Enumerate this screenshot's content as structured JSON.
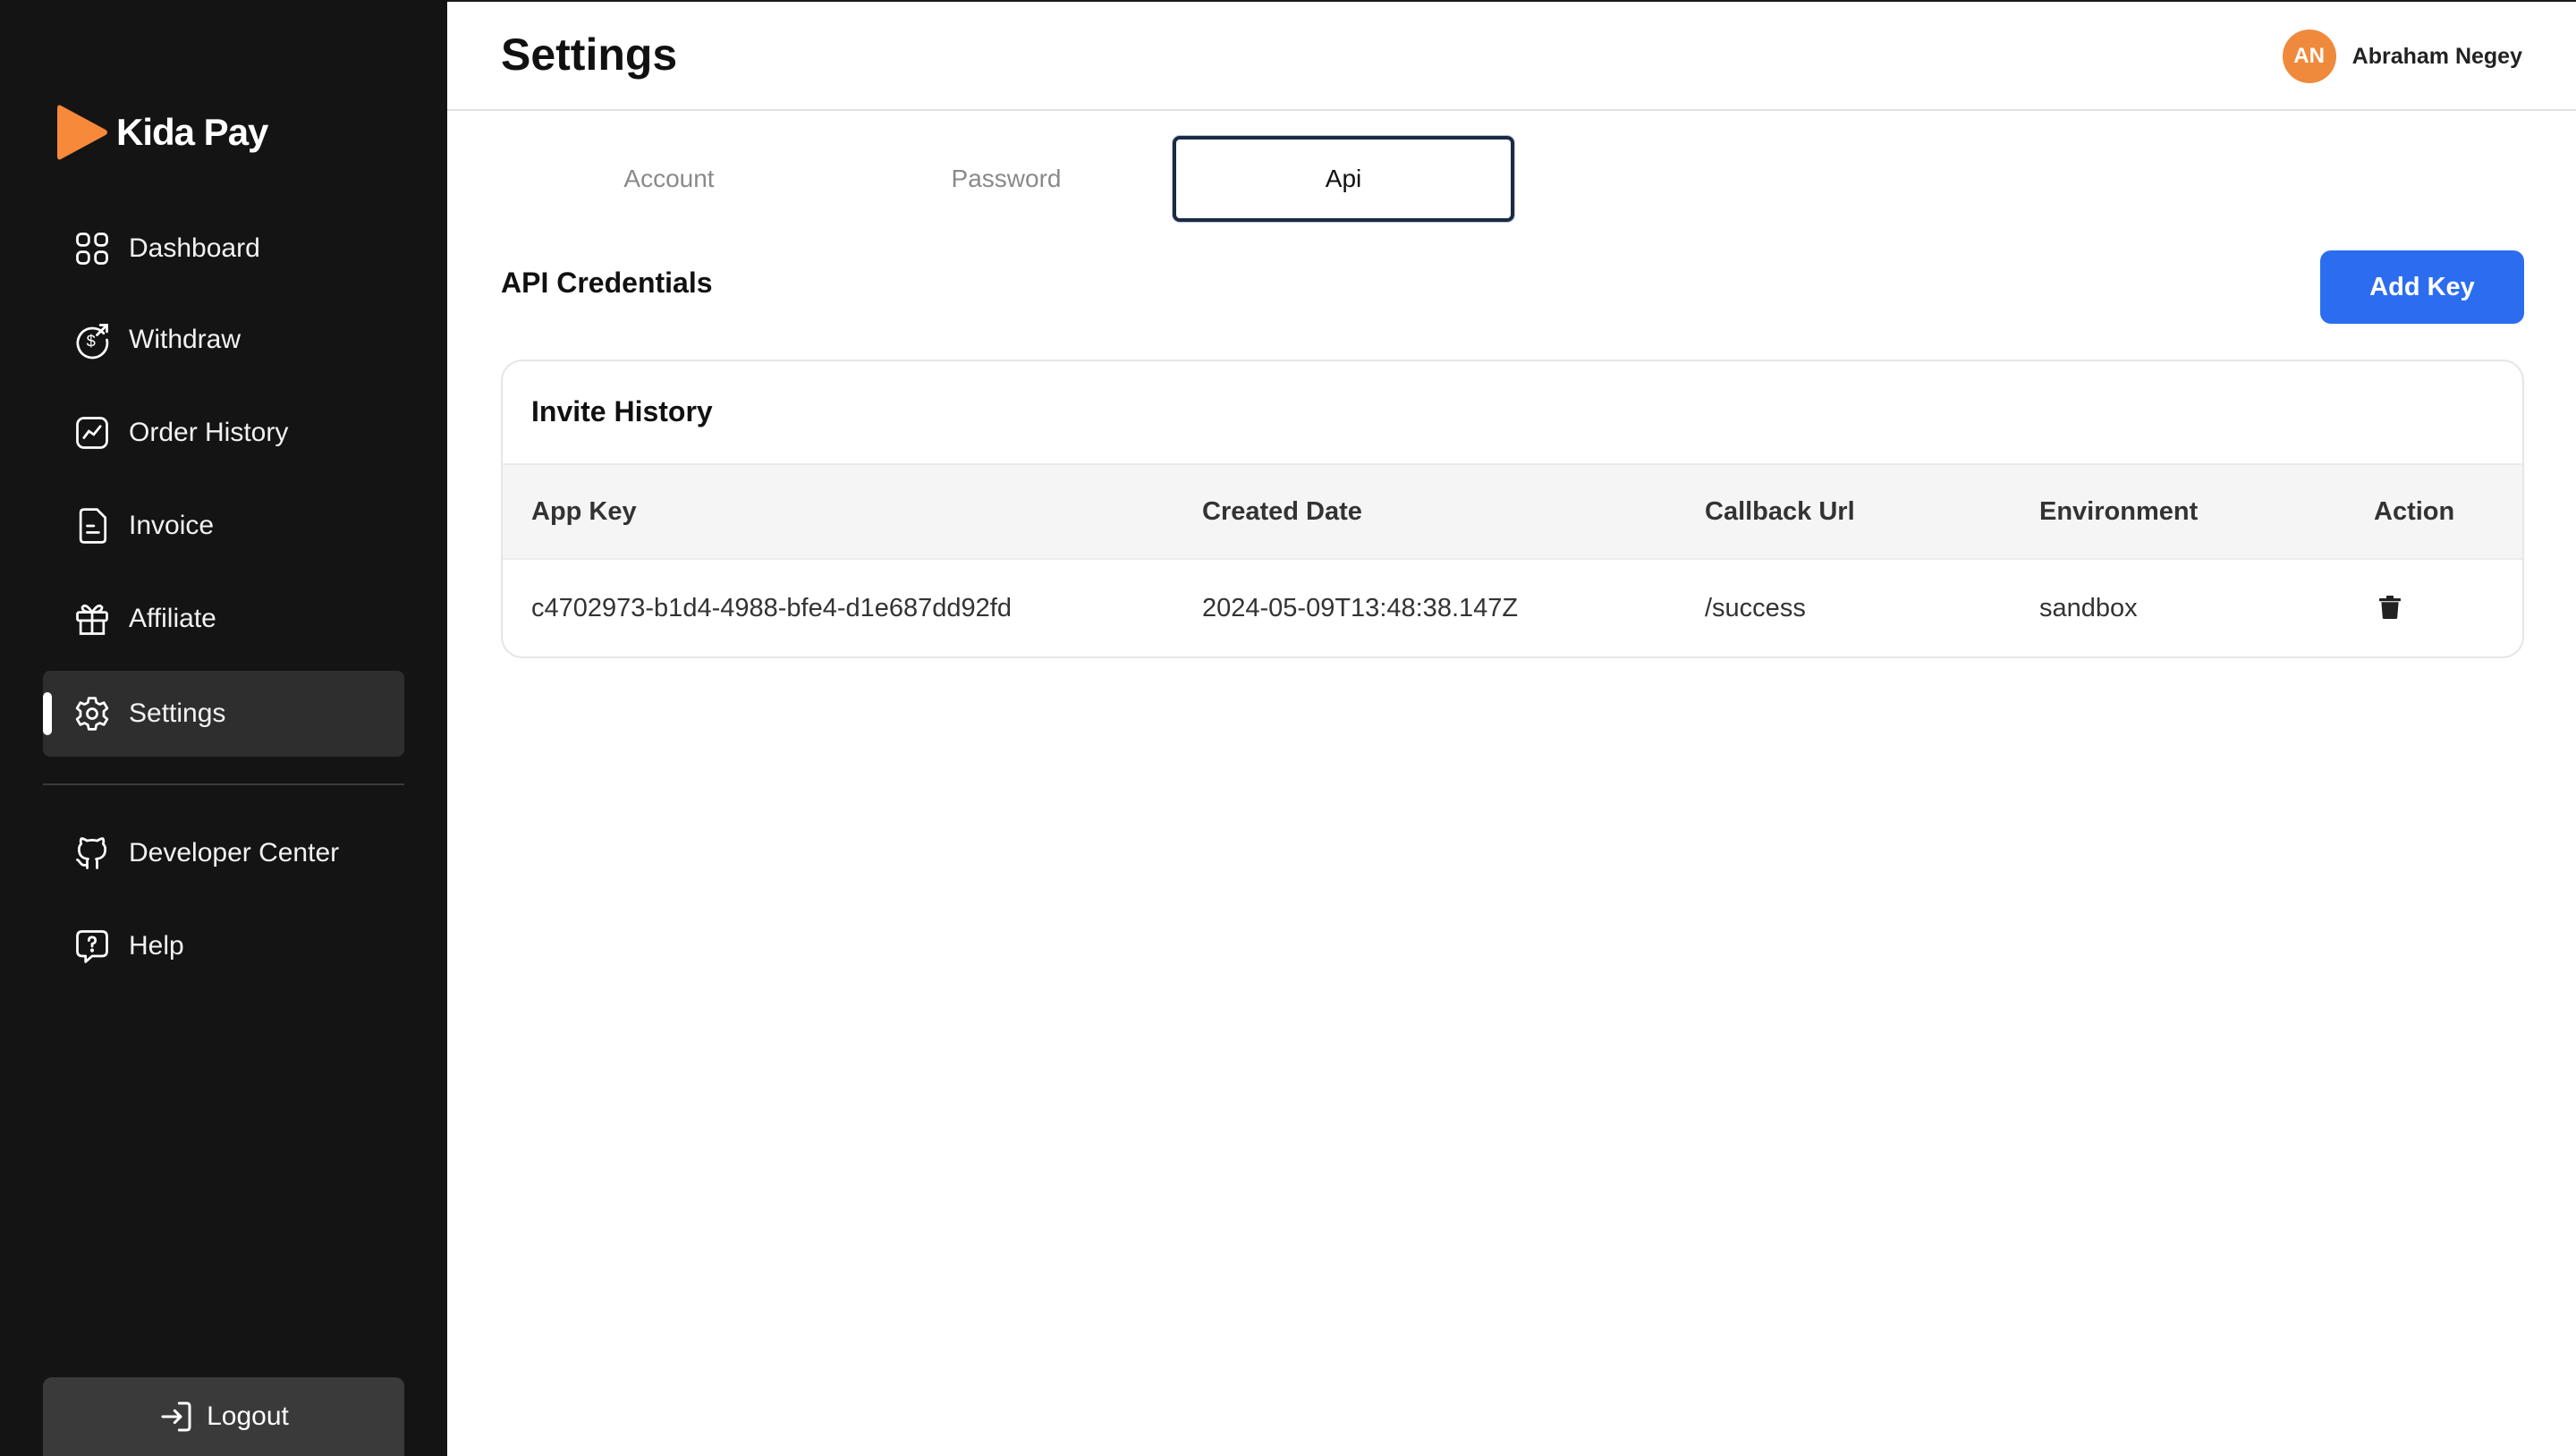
{
  "brand": {
    "name": "Kida Pay",
    "logo_color": "#f7893a"
  },
  "sidebar": {
    "items": [
      {
        "label": "Dashboard",
        "icon": "grid-icon"
      },
      {
        "label": "Withdraw",
        "icon": "dollar-refresh-icon"
      },
      {
        "label": "Order History",
        "icon": "chart-line-icon"
      },
      {
        "label": "Invoice",
        "icon": "document-icon"
      },
      {
        "label": "Affiliate",
        "icon": "gift-box-icon"
      },
      {
        "label": "Settings",
        "icon": "gear-icon",
        "active": true
      }
    ],
    "secondary": [
      {
        "label": "Developer Center",
        "icon": "github-icon"
      },
      {
        "label": "Help",
        "icon": "help-chat-icon"
      }
    ],
    "logout_label": "Logout"
  },
  "header": {
    "title": "Settings",
    "user": {
      "initials": "AN",
      "name": "Abraham Negey",
      "avatar_color": "#ef8a3c"
    }
  },
  "tabs": [
    {
      "label": "Account"
    },
    {
      "label": "Password"
    },
    {
      "label": "Api",
      "active": true
    }
  ],
  "credentials": {
    "title": "API Credentials",
    "add_button_label": "Add Key",
    "accent_color": "#2c6df0"
  },
  "table": {
    "title": "Invite History",
    "columns": [
      "App Key",
      "Created Date",
      "Callback Url",
      "Environment",
      "Action"
    ],
    "rows": [
      {
        "app_key": "c4702973-b1d4-4988-bfe4-d1e687dd92fd",
        "created_date": "2024-05-09T13:48:38.147Z",
        "callback_url": "/success",
        "environment": "sandbox",
        "action_icon": "trash-icon"
      }
    ]
  }
}
